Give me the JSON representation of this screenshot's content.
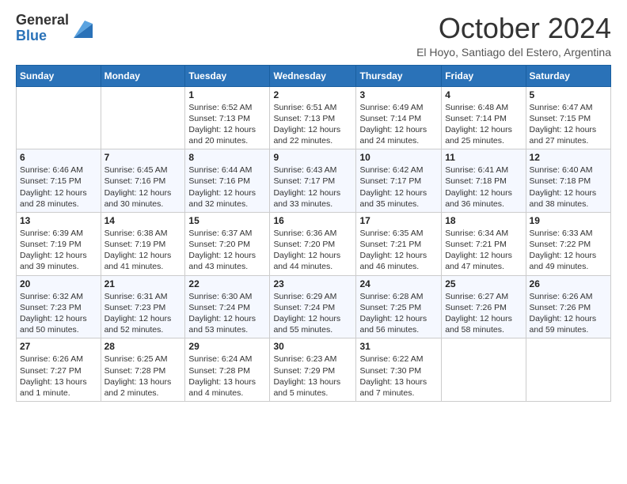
{
  "logo": {
    "general": "General",
    "blue": "Blue"
  },
  "title": "October 2024",
  "location": "El Hoyo, Santiago del Estero, Argentina",
  "days_of_week": [
    "Sunday",
    "Monday",
    "Tuesday",
    "Wednesday",
    "Thursday",
    "Friday",
    "Saturday"
  ],
  "weeks": [
    [
      {
        "day": "",
        "info": ""
      },
      {
        "day": "",
        "info": ""
      },
      {
        "day": "1",
        "info": "Sunrise: 6:52 AM\nSunset: 7:13 PM\nDaylight: 12 hours and 20 minutes."
      },
      {
        "day": "2",
        "info": "Sunrise: 6:51 AM\nSunset: 7:13 PM\nDaylight: 12 hours and 22 minutes."
      },
      {
        "day": "3",
        "info": "Sunrise: 6:49 AM\nSunset: 7:14 PM\nDaylight: 12 hours and 24 minutes."
      },
      {
        "day": "4",
        "info": "Sunrise: 6:48 AM\nSunset: 7:14 PM\nDaylight: 12 hours and 25 minutes."
      },
      {
        "day": "5",
        "info": "Sunrise: 6:47 AM\nSunset: 7:15 PM\nDaylight: 12 hours and 27 minutes."
      }
    ],
    [
      {
        "day": "6",
        "info": "Sunrise: 6:46 AM\nSunset: 7:15 PM\nDaylight: 12 hours and 28 minutes."
      },
      {
        "day": "7",
        "info": "Sunrise: 6:45 AM\nSunset: 7:16 PM\nDaylight: 12 hours and 30 minutes."
      },
      {
        "day": "8",
        "info": "Sunrise: 6:44 AM\nSunset: 7:16 PM\nDaylight: 12 hours and 32 minutes."
      },
      {
        "day": "9",
        "info": "Sunrise: 6:43 AM\nSunset: 7:17 PM\nDaylight: 12 hours and 33 minutes."
      },
      {
        "day": "10",
        "info": "Sunrise: 6:42 AM\nSunset: 7:17 PM\nDaylight: 12 hours and 35 minutes."
      },
      {
        "day": "11",
        "info": "Sunrise: 6:41 AM\nSunset: 7:18 PM\nDaylight: 12 hours and 36 minutes."
      },
      {
        "day": "12",
        "info": "Sunrise: 6:40 AM\nSunset: 7:18 PM\nDaylight: 12 hours and 38 minutes."
      }
    ],
    [
      {
        "day": "13",
        "info": "Sunrise: 6:39 AM\nSunset: 7:19 PM\nDaylight: 12 hours and 39 minutes."
      },
      {
        "day": "14",
        "info": "Sunrise: 6:38 AM\nSunset: 7:19 PM\nDaylight: 12 hours and 41 minutes."
      },
      {
        "day": "15",
        "info": "Sunrise: 6:37 AM\nSunset: 7:20 PM\nDaylight: 12 hours and 43 minutes."
      },
      {
        "day": "16",
        "info": "Sunrise: 6:36 AM\nSunset: 7:20 PM\nDaylight: 12 hours and 44 minutes."
      },
      {
        "day": "17",
        "info": "Sunrise: 6:35 AM\nSunset: 7:21 PM\nDaylight: 12 hours and 46 minutes."
      },
      {
        "day": "18",
        "info": "Sunrise: 6:34 AM\nSunset: 7:21 PM\nDaylight: 12 hours and 47 minutes."
      },
      {
        "day": "19",
        "info": "Sunrise: 6:33 AM\nSunset: 7:22 PM\nDaylight: 12 hours and 49 minutes."
      }
    ],
    [
      {
        "day": "20",
        "info": "Sunrise: 6:32 AM\nSunset: 7:23 PM\nDaylight: 12 hours and 50 minutes."
      },
      {
        "day": "21",
        "info": "Sunrise: 6:31 AM\nSunset: 7:23 PM\nDaylight: 12 hours and 52 minutes."
      },
      {
        "day": "22",
        "info": "Sunrise: 6:30 AM\nSunset: 7:24 PM\nDaylight: 12 hours and 53 minutes."
      },
      {
        "day": "23",
        "info": "Sunrise: 6:29 AM\nSunset: 7:24 PM\nDaylight: 12 hours and 55 minutes."
      },
      {
        "day": "24",
        "info": "Sunrise: 6:28 AM\nSunset: 7:25 PM\nDaylight: 12 hours and 56 minutes."
      },
      {
        "day": "25",
        "info": "Sunrise: 6:27 AM\nSunset: 7:26 PM\nDaylight: 12 hours and 58 minutes."
      },
      {
        "day": "26",
        "info": "Sunrise: 6:26 AM\nSunset: 7:26 PM\nDaylight: 12 hours and 59 minutes."
      }
    ],
    [
      {
        "day": "27",
        "info": "Sunrise: 6:26 AM\nSunset: 7:27 PM\nDaylight: 13 hours and 1 minute."
      },
      {
        "day": "28",
        "info": "Sunrise: 6:25 AM\nSunset: 7:28 PM\nDaylight: 13 hours and 2 minutes."
      },
      {
        "day": "29",
        "info": "Sunrise: 6:24 AM\nSunset: 7:28 PM\nDaylight: 13 hours and 4 minutes."
      },
      {
        "day": "30",
        "info": "Sunrise: 6:23 AM\nSunset: 7:29 PM\nDaylight: 13 hours and 5 minutes."
      },
      {
        "day": "31",
        "info": "Sunrise: 6:22 AM\nSunset: 7:30 PM\nDaylight: 13 hours and 7 minutes."
      },
      {
        "day": "",
        "info": ""
      },
      {
        "day": "",
        "info": ""
      }
    ]
  ]
}
